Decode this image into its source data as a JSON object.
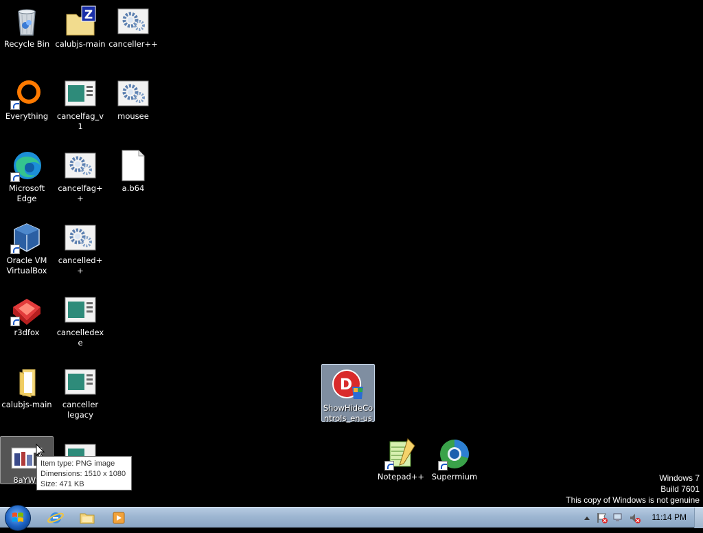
{
  "desktop_icons": [
    {
      "id": "recycle-bin",
      "label": "Recycle Bin"
    },
    {
      "id": "calubjs-main-zip",
      "label": "calubjs-main"
    },
    {
      "id": "canceller-pp",
      "label": "canceller++"
    },
    {
      "id": "everything",
      "label": "Everything"
    },
    {
      "id": "cancelfag-v1",
      "label": "cancelfag_v1"
    },
    {
      "id": "mousee",
      "label": "mousee"
    },
    {
      "id": "microsoft-edge",
      "label": "Microsoft Edge"
    },
    {
      "id": "cancelfag-pp",
      "label": "cancelfag++"
    },
    {
      "id": "a-b64",
      "label": "a.b64"
    },
    {
      "id": "virtualbox",
      "label": "Oracle VM VirtualBox"
    },
    {
      "id": "cancelled-pp",
      "label": "cancelled++"
    },
    {
      "id": "r3dfox",
      "label": "r3dfox"
    },
    {
      "id": "cancelledexe",
      "label": "cancelledexe"
    },
    {
      "id": "calubjs-main-folder",
      "label": "calubjs-main"
    },
    {
      "id": "canceller-legacy",
      "label": "canceller legacy"
    },
    {
      "id": "8aywy",
      "label": "8aYWy"
    },
    {
      "id": "app-under-tooltip",
      "label": ""
    },
    {
      "id": "showhidecontrols",
      "label": "ShowHideControls_en-us"
    },
    {
      "id": "notepad-pp",
      "label": "Notepad++"
    },
    {
      "id": "supermium",
      "label": "Supermium"
    }
  ],
  "tooltip": {
    "line1": "Item type: PNG image",
    "line2": "Dimensions: 1510 x 1080",
    "line3": "Size: 471 KB"
  },
  "watermark": {
    "line1": "Windows 7",
    "line2": "Build 7601",
    "line3": "This copy of Windows is not genuine"
  },
  "taskbar": {
    "pinned": [
      {
        "name": "internet-explorer-icon"
      },
      {
        "name": "windows-explorer-icon"
      },
      {
        "name": "media-player-icon"
      }
    ],
    "clock": "11:14 PM"
  }
}
